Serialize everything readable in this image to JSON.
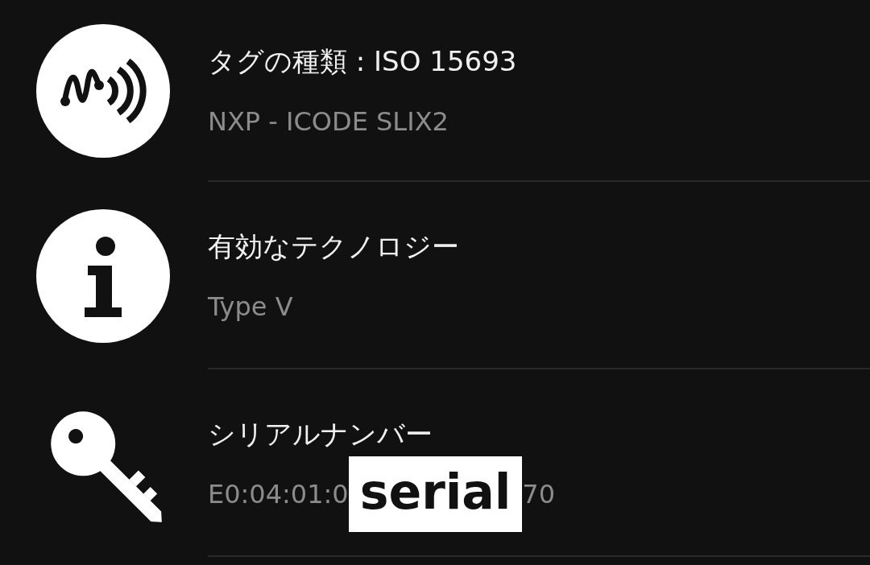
{
  "rows": [
    {
      "kind": "nfc",
      "title": "タグの種類 : ISO 15693",
      "subtitle": "NXP - ICODE SLIX2"
    },
    {
      "kind": "info",
      "title": "有効なテクノロジー",
      "subtitle": "Type V"
    },
    {
      "kind": "key",
      "title": "シリアルナンバー",
      "subtitle": "E0:04:01:0",
      "subtitle_end": "70",
      "redaction_label": "serial"
    }
  ]
}
